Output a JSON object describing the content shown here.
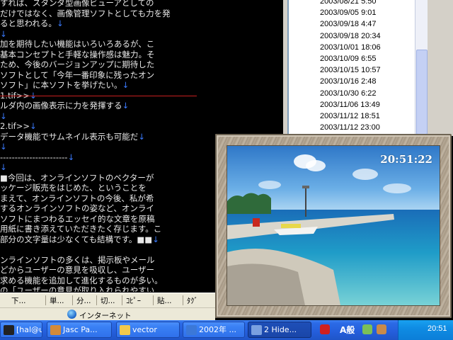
{
  "editor": {
    "lines": [
      {
        "text": "すれば、スタンダ型画像ビューアとしての",
        "arrow": ""
      },
      {
        "text": "だけではなく、画像管理ソフトとしても力を発",
        "arrow": ""
      },
      {
        "text": "ると思われる。",
        "arrow": "↓"
      },
      {
        "text": "",
        "arrow": "↓"
      },
      {
        "text": "加を期待したい機能はいろいろあるが、こ",
        "arrow": ""
      },
      {
        "text": "基本コンセプトと手軽な操作感は魅力。そ",
        "arrow": ""
      },
      {
        "text": "ため、今後のバージョンアップに期待した",
        "arrow": ""
      },
      {
        "text": "ソフトとして「今年一番印象に残ったオン",
        "arrow": ""
      },
      {
        "text": "ソフト」に本ソフトを挙げたい。",
        "arrow": "↓"
      },
      {
        "text": "1.tif>>",
        "arrow": "↓",
        "code": true
      },
      {
        "text": "ルダ内の画像表示に力を発揮する",
        "arrow": "↓"
      },
      {
        "text": "",
        "arrow": "↓"
      },
      {
        "text": "2.tif>>",
        "arrow": "↓",
        "code": true
      },
      {
        "text": "データ機能でサムネイル表示も可能だ",
        "arrow": "↓"
      },
      {
        "text": "",
        "arrow": "↓"
      },
      {
        "text": "-----------------------",
        "arrow": "↓"
      },
      {
        "text": "",
        "arrow": "↓"
      },
      {
        "text": "■今回は、オンラインソフトのベクターが",
        "arrow": ""
      },
      {
        "text": "ッケージ販売をはじめた、ということを",
        "arrow": ""
      },
      {
        "text": "まえて、オンラインソフトの今後、私が希",
        "arrow": ""
      },
      {
        "text": "するオンラインソフトの姿など、オンライ",
        "arrow": ""
      },
      {
        "text": "ソフトにまつわるエッセイ的な文章を原稿",
        "arrow": ""
      },
      {
        "text": "用紙に書き添えていただきたく存じます。こ",
        "arrow": ""
      },
      {
        "text": "部分の文字量は少なくても結構です。■■",
        "arrow": "↓"
      },
      {
        "text": "",
        "arrow": ""
      },
      {
        "text": "ンラインソフトの多くは、掲示板やメール",
        "arrow": ""
      },
      {
        "text": "どからユーザーの意見を吸収し、ユーザー",
        "arrow": ""
      },
      {
        "text": "求める機能を追加して進化するものが多い。",
        "arrow": ""
      },
      {
        "text": "の「ユーザーの意見が取り入れられやすい",
        "arrow": ""
      }
    ]
  },
  "date_list": [
    "2003/08/21 5:50",
    "2003/09/05 9:01",
    "2003/09/18 4:47",
    "2003/09/18 20:34",
    "2003/10/01 18:06",
    "2003/10/09 6:55",
    "2003/10/15 10:57",
    "2003/10/16 2:48",
    "2003/10/30 6:22",
    "2003/11/06 13:49",
    "2003/11/12 18:51",
    "2003/11/12 23:00"
  ],
  "clock": {
    "time": "20:51:22"
  },
  "toolbar": {
    "buttons": [
      "下...",
      "単...",
      "分...",
      "切...",
      "ｺﾋﾟｰ",
      "貼...",
      "ﾀｸﾞ"
    ]
  },
  "status": {
    "zone": "インターネット"
  },
  "taskbar": {
    "items": [
      {
        "label": "[hal@us...",
        "icon": "terminal-icon",
        "color": "#222"
      },
      {
        "label": "Jasc Pa...",
        "icon": "paint-palette-icon",
        "color": "#d28a3a"
      },
      {
        "label": "vector",
        "icon": "folder-icon",
        "color": "#f2c94c"
      },
      {
        "label": "2002年 ...",
        "icon": "document-icon",
        "color": "#3b78d8"
      },
      {
        "label": "2 Hide...",
        "icon": "hidemaru-editor-icon",
        "color": "#7aa0e0"
      }
    ],
    "ime": "A般",
    "tray_time": "20:51"
  }
}
